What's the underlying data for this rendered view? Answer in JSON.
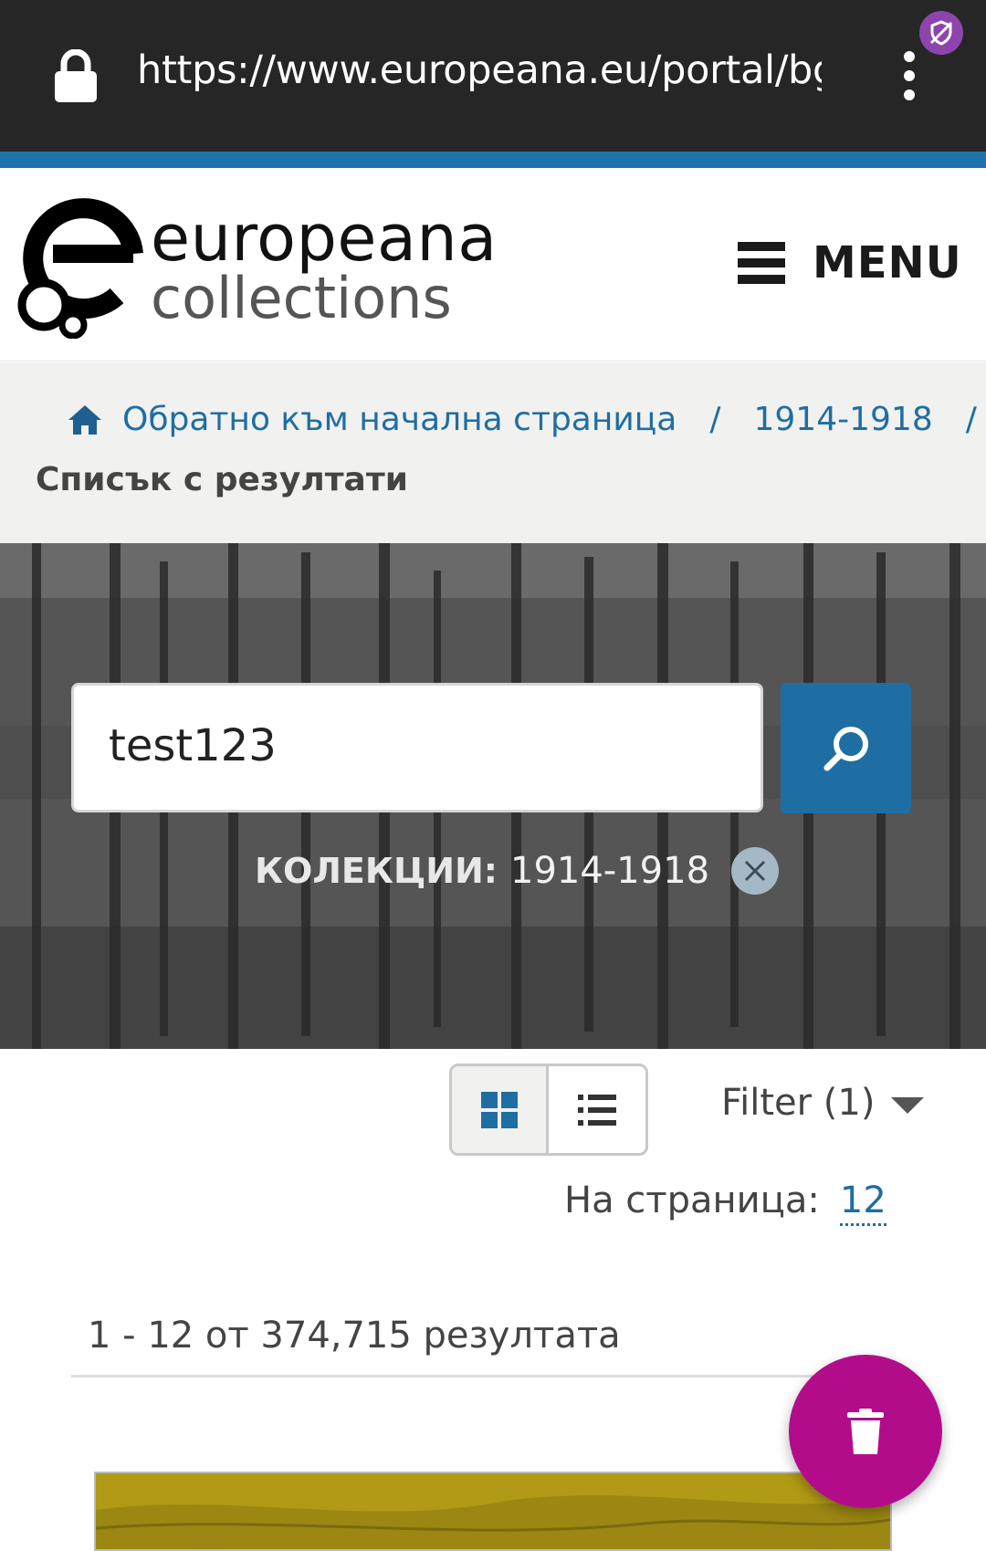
{
  "browser": {
    "url": "https://www.europeana.eu/portal/bg/",
    "lock_icon": "lock-icon",
    "menu_icon": "more-vert-icon",
    "extension_icon": "privacy-badge-icon"
  },
  "header": {
    "logo_line1": "europeana",
    "logo_line2": "collections",
    "menu_label": "MENU",
    "menu_icon": "hamburger-icon"
  },
  "breadcrumb": {
    "home_icon": "home-icon",
    "home_label": "Обратно към начална страница",
    "separator": "/",
    "collection_label": "1914-1918",
    "current": "Списък с резултати"
  },
  "search": {
    "query": "test123",
    "button_icon": "search-icon",
    "filter_label": "КОЛЕКЦИИ:",
    "filter_value": "1914-1918",
    "remove_icon": "close-icon"
  },
  "toolbar": {
    "grid_icon": "grid-view-icon",
    "list_icon": "list-view-icon",
    "filter_label": "Filter (1)",
    "per_page_label": "На страница:",
    "per_page_value": "12"
  },
  "results": {
    "count_text": "1 - 12 от 374,715 резултата"
  },
  "fab": {
    "icon": "trash-icon"
  },
  "colors": {
    "brand_blue": "#1f6ea3",
    "fab_magenta": "#b30c8a",
    "urlbar_bg": "#262626"
  }
}
